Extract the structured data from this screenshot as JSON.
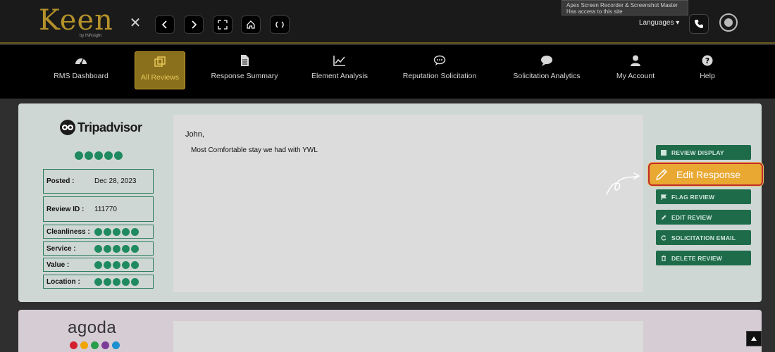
{
  "brand": {
    "name": "Keen",
    "sub": "by INNsight"
  },
  "extension_popup": {
    "line1": "Apex Screen Recorder & Screenshot Master",
    "line2": "Has access to this site"
  },
  "header": {
    "languages": "Languages ▾"
  },
  "nav": [
    {
      "label": "RMS Dashboard",
      "icon": "dashboard-icon"
    },
    {
      "label": "All Reviews",
      "icon": "reviews-icon",
      "active": true
    },
    {
      "label": "Response Summary",
      "icon": "document-icon"
    },
    {
      "label": "Element Analysis",
      "icon": "line-chart-icon"
    },
    {
      "label": "Reputation Solicitation",
      "icon": "chat-bubble-icon"
    },
    {
      "label": "Solicitation Analytics",
      "icon": "comment-icon"
    },
    {
      "label": "My Account",
      "icon": "user-icon"
    },
    {
      "label": "Help",
      "icon": "question-icon"
    }
  ],
  "review": {
    "source": "Tripadvisor",
    "rating": 5,
    "posted_label": "Posted :",
    "posted_value": "Dec 28, 2023",
    "id_label": "Review ID :",
    "id_value": "111770",
    "categories": [
      {
        "label": "Cleanliness :",
        "rating": 5
      },
      {
        "label": "Service :",
        "rating": 5
      },
      {
        "label": "Value :",
        "rating": 5
      },
      {
        "label": "Location :",
        "rating": 5
      }
    ],
    "reviewer": "John,",
    "text": "Most Comfortable stay we had with YWL"
  },
  "actions": {
    "review_display": "REVIEW DISPLAY",
    "edit_response": "Edit Response",
    "flag_review": "FLAG REVIEW",
    "edit_review": "EDIT REVIEW",
    "solicitation_email": "SOLICITATION EMAIL",
    "delete_review": "DELETE REVIEW"
  },
  "second_review": {
    "source": "agoda"
  },
  "colors": {
    "accent_gold": "#b4912a",
    "button_green": "#1e6b4a",
    "callout_orange": "#e9a832",
    "callout_border": "#c12c2c"
  }
}
